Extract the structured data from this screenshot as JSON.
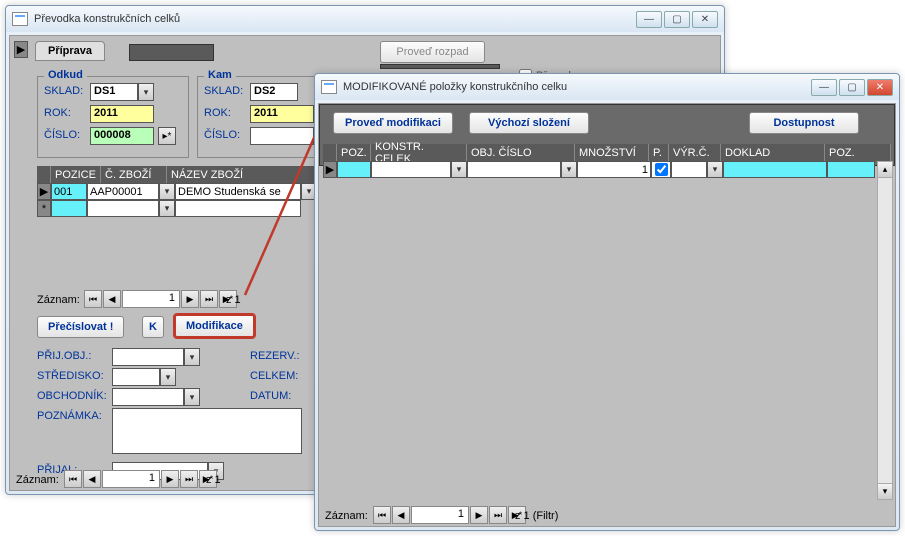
{
  "win1": {
    "title": "Převodka konstrukčních celků",
    "tab": "Příprava",
    "btn_rozpad": "Proveď rozpad",
    "chk_prevod": "Převod",
    "odkud": {
      "title": "Odkud",
      "sklad_lbl": "SKLAD:",
      "sklad": "DS1",
      "rok_lbl": "ROK:",
      "rok": "2011",
      "cislo_lbl": "ČÍSLO:",
      "cislo": "000008"
    },
    "kam": {
      "title": "Kam",
      "sklad_lbl": "SKLAD:",
      "sklad": "DS2",
      "rok_lbl": "ROK:",
      "rok": "2011",
      "cislo_lbl": "ČÍSLO:"
    },
    "cols": {
      "poz": "POZICE",
      "czbozi": "Č. ZBOŽÍ",
      "nazev": "NÁZEV ZBOŽÍ"
    },
    "row": {
      "poz": "001",
      "czbozi": "AAP00001",
      "nazev": "DEMO Studenská se"
    },
    "nav_label": "Záznam:",
    "nav_pos": "1",
    "nav_z": "z  1",
    "btn_precislovat": "Přečíslovat !",
    "btn_k": "K",
    "btn_modifikace": "Modifikace",
    "fields": {
      "prijobj": "PŘIJ.OBJ.:",
      "rezerv": "REZERV.:",
      "stredisko": "STŘEDISKO:",
      "celkem": "CELKEM:",
      "obchodnik": "OBCHODNÍK:",
      "datum": "DATUM:",
      "poznamka": "POZNÁMKA:",
      "prijal": "PŘIJAL:"
    },
    "nav2_label": "Záznam:",
    "nav2_pos": "1",
    "nav2_z": "z  1"
  },
  "win2": {
    "title": "MODIFIKOVANÉ položky konstrukčního celku",
    "btn_proved": "Proveď modifikaci",
    "btn_vychozi": "Výchozí složení",
    "btn_dostupnost": "Dostupnost",
    "cols": {
      "poz": "POZ.",
      "kc": "KONSTR. CELEK",
      "objc": "OBJ. ČÍSLO",
      "mnoz": "MNOŽSTVÍ",
      "p": "P.",
      "vyrc": "VÝR.Č.",
      "doklad": "DOKLAD",
      "poz2": "POZ."
    },
    "row_mnoz": "1",
    "nav_label": "Záznam:",
    "nav_pos": "1",
    "nav_z": "z  1 (Filtr)"
  }
}
